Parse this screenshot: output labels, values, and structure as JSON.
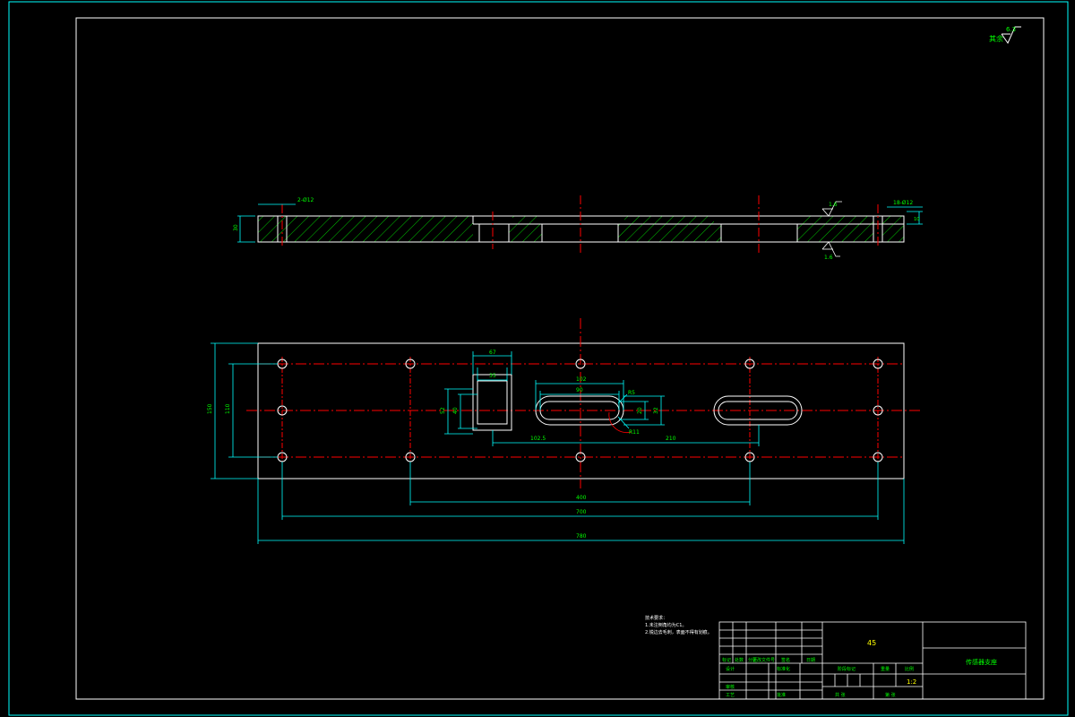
{
  "colors": {
    "background": "#000000",
    "frame": "#00ffff",
    "outline": "#ffffff",
    "centerline": "#ff0000",
    "hatch": "#00ff00",
    "dimension": "#00ffff",
    "text_green": "#00ff00",
    "text_yellow": "#ffff00"
  },
  "roughness": {
    "corner_label": "其余",
    "corner_value": "6.3",
    "top_value": "1.6",
    "bottom_value": "1.6"
  },
  "side_view": {
    "hole_callout_left": "2-Ø12",
    "hole_callout_right": "18-Ø12",
    "height_dim": "30",
    "right_height_dim": "10"
  },
  "plan_view": {
    "dims": {
      "overall_length": "780",
      "hole_span_outer": "700",
      "hole_span_inner": "400",
      "width_outer": "150",
      "width_inner": "110",
      "sq_outer_w": "67",
      "sq_inner_w": "35",
      "sq_outer_h": "52",
      "sq_inner_h": "40",
      "slot_len": "102",
      "slot_inner": "90",
      "slot_r_small": "R5",
      "slot_w_outer": "32",
      "slot_w_inner": "20",
      "slot_r_large": "R11",
      "offset_left": "102.5",
      "offset_right": "210"
    }
  },
  "notes": {
    "heading": "技术要求：",
    "lines": [
      "1.未注倒角均为C1。",
      "2.锐边去毛刺，表面不得有划痕。"
    ]
  },
  "title_block": {
    "material": "45",
    "part_name": "传感器支座",
    "scale": "1:2",
    "rev_headers": [
      "标记",
      "处数",
      "分区",
      "更改文件号",
      "签名",
      "日期"
    ],
    "design_row": [
      "设计",
      "标准化"
    ],
    "stage_label": "阶段标记",
    "weight_label": "重量",
    "scale_label": "比例",
    "review_label": "审核",
    "process_label": "工艺",
    "approve_label": "批准",
    "sheet_total": "共  张",
    "sheet_no": "第  张"
  }
}
